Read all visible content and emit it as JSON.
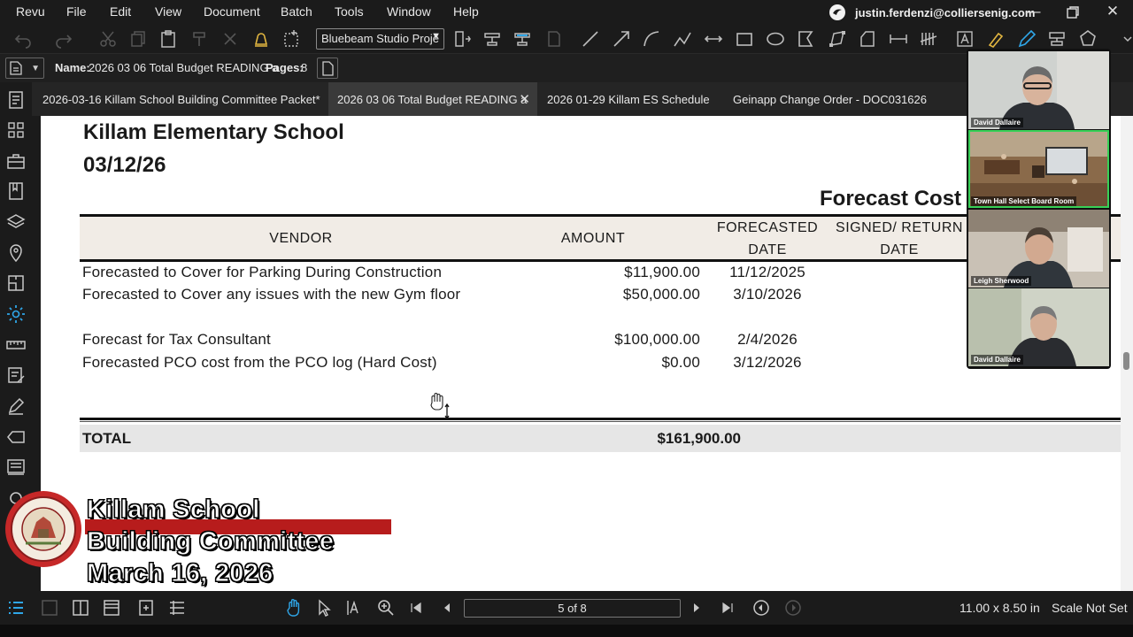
{
  "menubar": {
    "items": [
      "Revu",
      "File",
      "Edit",
      "View",
      "Document",
      "Batch",
      "Tools",
      "Window",
      "Help"
    ],
    "account_email": "justin.ferdenzi@colliersenig.com"
  },
  "toolbar": {
    "profile": "Bluebeam Studio Proje"
  },
  "filebar": {
    "name_label": "Name:",
    "name_value": "2026 03 06 Total Budget READING a",
    "pages_label": "Pages:",
    "pages_value": "8"
  },
  "tabs": [
    {
      "label": "2026-03-16 Killam School Building Committee Packet*",
      "active": false
    },
    {
      "label": "2026 03 06 Total Budget READING a",
      "active": true
    },
    {
      "label": "2026 01-29 Killam ES Schedule",
      "active": false
    },
    {
      "label": "Geinapp Change Order - DOC031626",
      "active": false
    }
  ],
  "document": {
    "school": "Killam Elementary School",
    "date": "03/12/26",
    "section_title": "Forecast Cost",
    "columns": {
      "vendor": "VENDOR",
      "amount": "AMOUNT",
      "forecasted_date_1": "FORECASTED",
      "forecasted_date_2": "DATE",
      "signed_return_1": "SIGNED/ RETURN",
      "signed_return_2": "DATE"
    },
    "rows": [
      {
        "vendor": "Forecasted to Cover for Parking During Construction",
        "amount": "$11,900.00",
        "date": "11/12/2025"
      },
      {
        "vendor": "Forecasted to Cover any issues with the new Gym floor",
        "amount": "$50,000.00",
        "date": "3/10/2026"
      },
      {
        "vendor": "Forecast for Tax Consultant",
        "amount": "$100,000.00",
        "date": "2/4/2026"
      },
      {
        "vendor": "Forecasted PCO cost from the PCO log (Hard Cost)",
        "amount": "$0.00",
        "date": "3/12/2026"
      }
    ],
    "total_label": "TOTAL",
    "total_amount": "$161,900.00"
  },
  "video": {
    "participants": [
      "David Dallaire",
      "Town Hall Select Board Room",
      "Leigh Sherwood",
      "David Dallaire"
    ]
  },
  "brand": {
    "line1": "Killam School",
    "line2": "Building Committee",
    "line3": "March 16, 2026",
    "accent_color": "#b71c1c"
  },
  "bottombar": {
    "page_indicator": "5 of 8",
    "page_size": "11.00 x 8.50 in",
    "scale": "Scale Not Set"
  },
  "colors": {
    "accent": "#2fa6e8",
    "speaker_outline": "#37d157",
    "table_header_bg": "#f1ece6"
  }
}
